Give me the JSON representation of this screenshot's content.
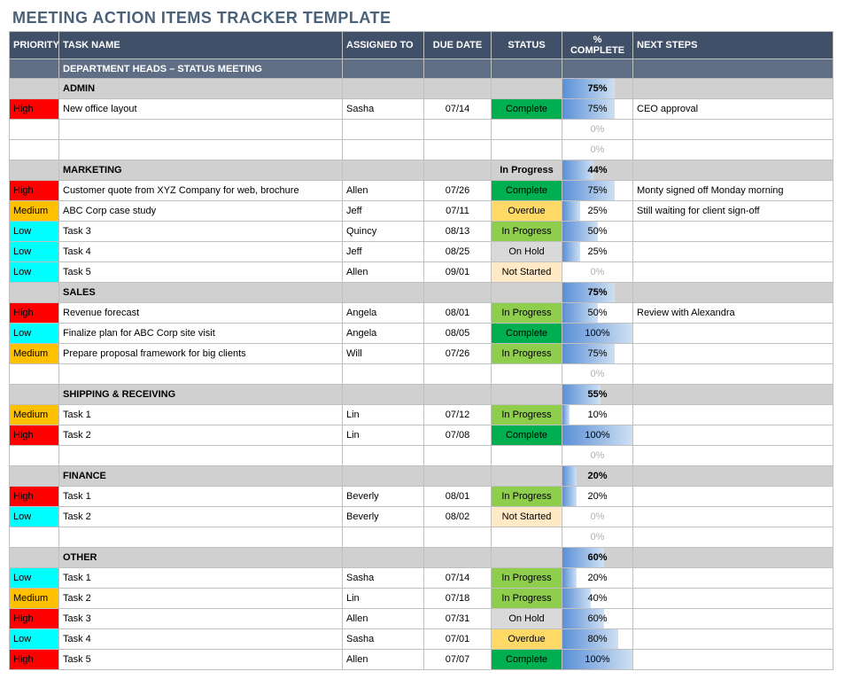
{
  "title": "MEETING ACTION ITEMS TRACKER TEMPLATE",
  "headers": {
    "priority": "PRIORITY",
    "task": "TASK NAME",
    "assigned": "ASSIGNED TO",
    "due": "DUE DATE",
    "status": "STATUS",
    "pct": "% COMPLETE",
    "next": "NEXT STEPS"
  },
  "meeting_title": "DEPARTMENT HEADS – STATUS MEETING",
  "status_labels": {
    "complete": "Complete",
    "inprogress": "In Progress",
    "overdue": "Overdue",
    "onhold": "On Hold",
    "notstarted": "Not Started"
  },
  "priority_labels": {
    "high": "High",
    "medium": "Medium",
    "low": "Low"
  },
  "sections": [
    {
      "name": "ADMIN",
      "summary_pct": 75,
      "rows": [
        {
          "priority": "high",
          "task": "New office layout",
          "assigned": "Sasha",
          "due": "07/14",
          "status": "complete",
          "pct": 75,
          "next": "CEO approval"
        },
        {
          "priority": "",
          "task": "",
          "assigned": "",
          "due": "",
          "status": "",
          "pct": 0,
          "next": ""
        },
        {
          "priority": "",
          "task": "",
          "assigned": "",
          "due": "",
          "status": "",
          "pct": 0,
          "next": ""
        }
      ]
    },
    {
      "name": "MARKETING",
      "summary_status": "inprogress",
      "summary_pct": 44,
      "rows": [
        {
          "priority": "high",
          "task": "Customer quote from XYZ Company for web, brochure",
          "assigned": "Allen",
          "due": "07/26",
          "status": "complete",
          "pct": 75,
          "next": "Monty signed off Monday morning"
        },
        {
          "priority": "medium",
          "task": "ABC Corp case study",
          "assigned": "Jeff",
          "due": "07/11",
          "status": "overdue",
          "pct": 25,
          "next": "Still waiting for client sign-off"
        },
        {
          "priority": "low",
          "task": "Task 3",
          "assigned": "Quincy",
          "due": "08/13",
          "status": "inprogress",
          "pct": 50,
          "next": ""
        },
        {
          "priority": "low",
          "task": "Task 4",
          "assigned": "Jeff",
          "due": "08/25",
          "status": "onhold",
          "pct": 25,
          "next": ""
        },
        {
          "priority": "low",
          "task": "Task 5",
          "assigned": "Allen",
          "due": "09/01",
          "status": "notstarted",
          "pct": 0,
          "next": ""
        }
      ]
    },
    {
      "name": "SALES",
      "summary_pct": 75,
      "rows": [
        {
          "priority": "high",
          "task": "Revenue forecast",
          "assigned": "Angela",
          "due": "08/01",
          "status": "inprogress",
          "pct": 50,
          "next": "Review with Alexandra"
        },
        {
          "priority": "low",
          "task": "Finalize plan for ABC Corp site visit",
          "assigned": "Angela",
          "due": "08/05",
          "status": "complete",
          "pct": 100,
          "next": ""
        },
        {
          "priority": "medium",
          "task": "Prepare proposal framework for big clients",
          "assigned": "Will",
          "due": "07/26",
          "status": "inprogress",
          "pct": 75,
          "next": ""
        },
        {
          "priority": "",
          "task": "",
          "assigned": "",
          "due": "",
          "status": "",
          "pct": 0,
          "next": ""
        }
      ]
    },
    {
      "name": "SHIPPING & RECEIVING",
      "summary_pct": 55,
      "rows": [
        {
          "priority": "medium",
          "task": "Task 1",
          "assigned": "Lin",
          "due": "07/12",
          "status": "inprogress",
          "pct": 10,
          "next": ""
        },
        {
          "priority": "high",
          "task": "Task 2",
          "assigned": "Lin",
          "due": "07/08",
          "status": "complete",
          "pct": 100,
          "next": ""
        },
        {
          "priority": "",
          "task": "",
          "assigned": "",
          "due": "",
          "status": "",
          "pct": 0,
          "next": ""
        }
      ]
    },
    {
      "name": "FINANCE",
      "summary_pct": 20,
      "rows": [
        {
          "priority": "high",
          "task": "Task 1",
          "assigned": "Beverly",
          "due": "08/01",
          "status": "inprogress",
          "pct": 20,
          "next": ""
        },
        {
          "priority": "low",
          "task": "Task 2",
          "assigned": "Beverly",
          "due": "08/02",
          "status": "notstarted",
          "pct": 0,
          "next": ""
        },
        {
          "priority": "",
          "task": "",
          "assigned": "",
          "due": "",
          "status": "",
          "pct": 0,
          "next": ""
        }
      ]
    },
    {
      "name": "OTHER",
      "summary_pct": 60,
      "rows": [
        {
          "priority": "low",
          "task": "Task 1",
          "assigned": "Sasha",
          "due": "07/14",
          "status": "inprogress",
          "pct": 20,
          "next": ""
        },
        {
          "priority": "medium",
          "task": "Task 2",
          "assigned": "Lin",
          "due": "07/18",
          "status": "inprogress",
          "pct": 40,
          "next": ""
        },
        {
          "priority": "high",
          "task": "Task 3",
          "assigned": "Allen",
          "due": "07/31",
          "status": "onhold",
          "pct": 60,
          "next": ""
        },
        {
          "priority": "low",
          "task": "Task 4",
          "assigned": "Sasha",
          "due": "07/01",
          "status": "overdue",
          "pct": 80,
          "next": ""
        },
        {
          "priority": "high",
          "task": "Task 5",
          "assigned": "Allen",
          "due": "07/07",
          "status": "complete",
          "pct": 100,
          "next": ""
        }
      ]
    }
  ]
}
